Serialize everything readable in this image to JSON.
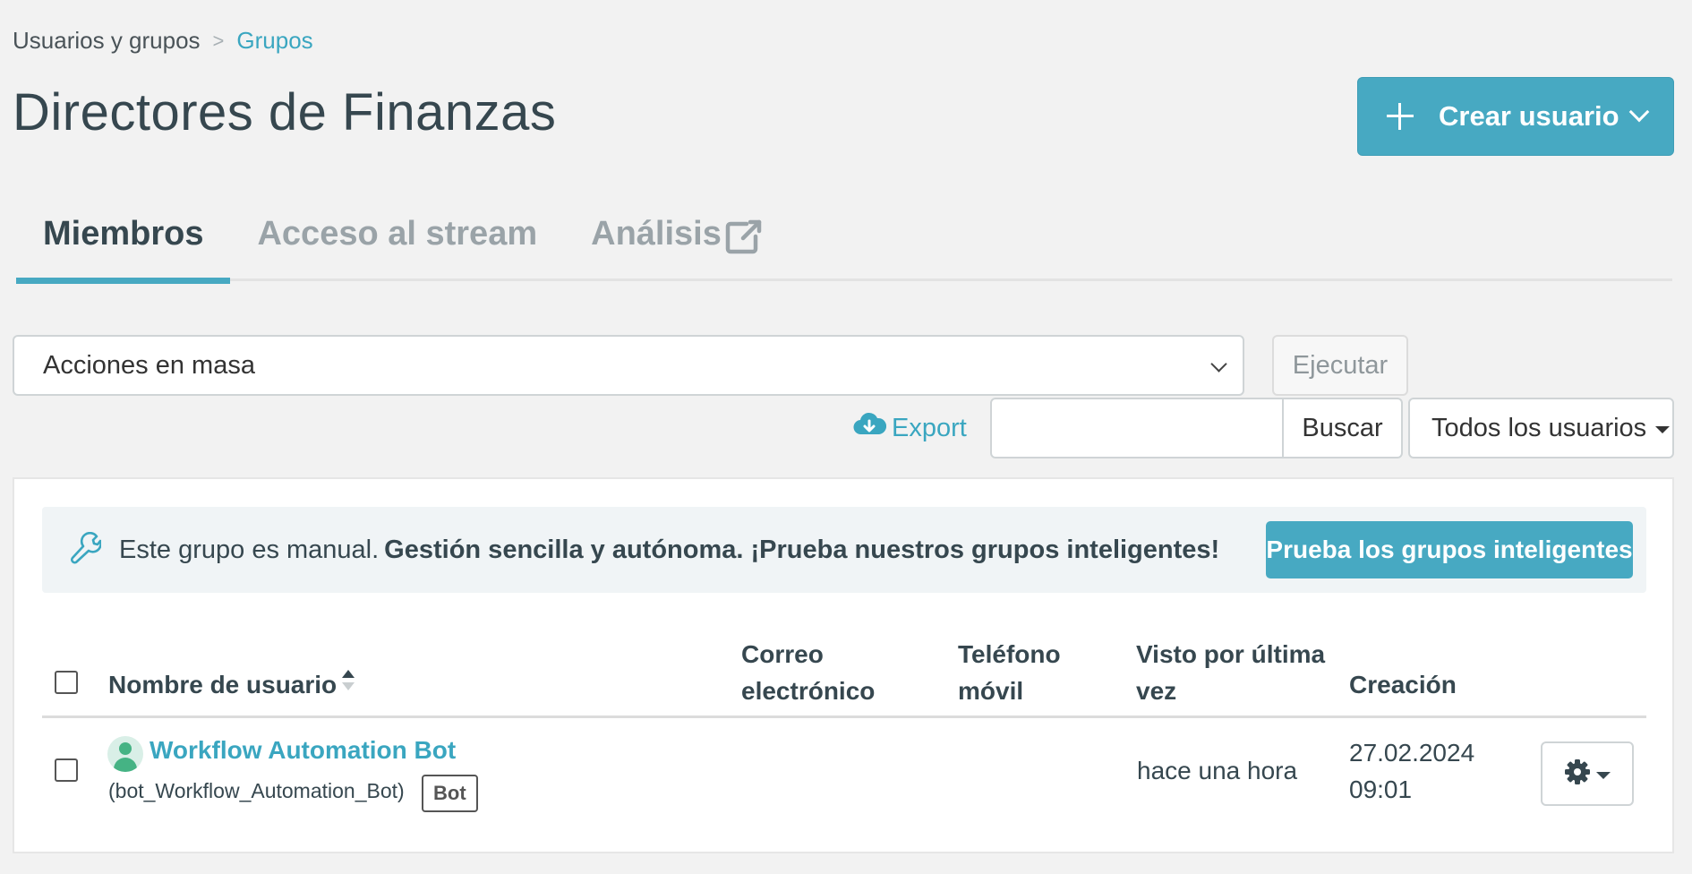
{
  "breadcrumb": {
    "parent": "Usuarios y grupos",
    "separator": ">",
    "current": "Grupos"
  },
  "page": {
    "title": "Directores de Finanzas"
  },
  "create_button": {
    "label": "Crear usuario"
  },
  "tabs": [
    {
      "label": "Miembros",
      "active": true
    },
    {
      "label": "Acceso al stream",
      "active": false
    },
    {
      "label": "Análisis",
      "active": false,
      "icon": "external-link-icon"
    }
  ],
  "bulk": {
    "selected": "Acciones en masa",
    "execute_label": "Ejecutar"
  },
  "toolbar": {
    "export_label": "Export",
    "search_value": "",
    "search_button": "Buscar",
    "filter_label": "Todos los usuarios"
  },
  "banner": {
    "icon": "wrench-icon",
    "text_plain": "Este grupo es manual.",
    "text_bold": "Gestión sencilla y autónoma. ¡Prueba nuestros grupos inteligentes!",
    "button_label": "Prueba los grupos inteligentes"
  },
  "table": {
    "columns": {
      "name": "Nombre de usuario",
      "email_line1": "Correo",
      "email_line2": "electrónico",
      "phone_line1": "Teléfono",
      "phone_line2": "móvil",
      "seen_line1": "Visto por última",
      "seen_line2": "vez",
      "created": "Creación"
    },
    "rows": [
      {
        "display_name": "Workflow Automation Bot",
        "username": "(bot_Workflow_Automation_Bot)",
        "badge": "Bot",
        "email": "",
        "phone": "",
        "last_seen": "hace una hora",
        "created_date": "27.02.2024",
        "created_time": "09:01"
      }
    ]
  },
  "colors": {
    "accent": "#47a9c2",
    "text": "#36474f",
    "link": "#3aa6c0",
    "avatar": "#45b384"
  }
}
